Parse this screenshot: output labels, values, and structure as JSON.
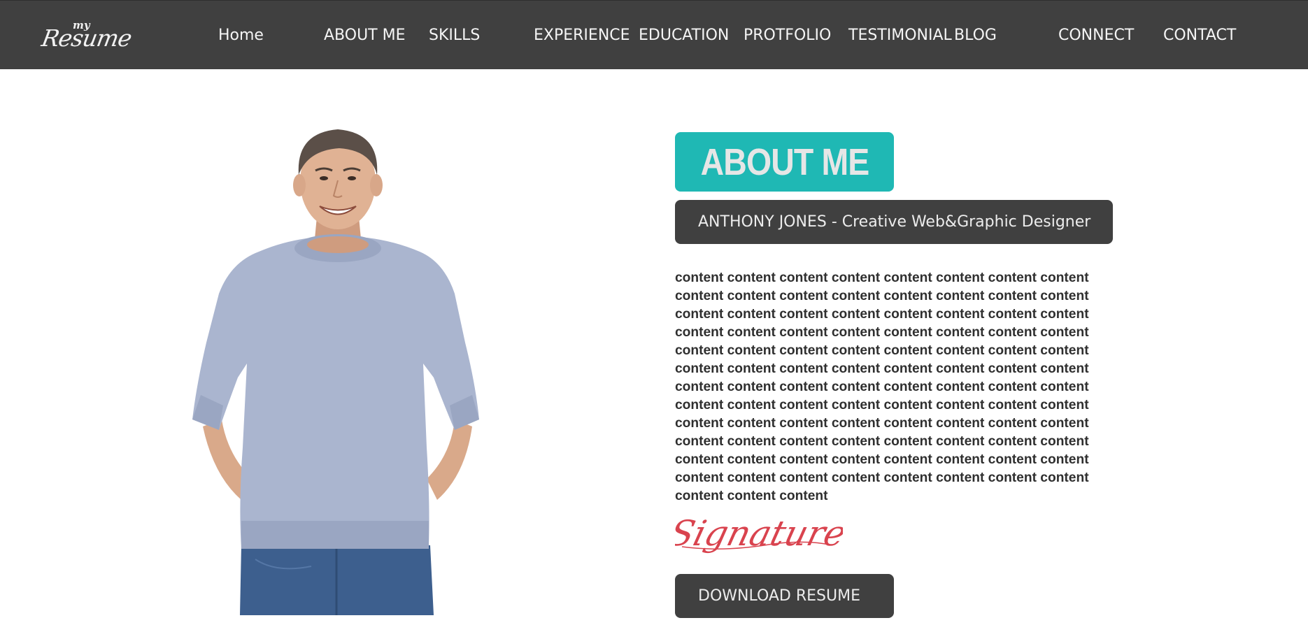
{
  "header": {
    "logo": {
      "small": "my",
      "main": "Resume"
    },
    "nav": [
      {
        "label": "Home"
      },
      {
        "label": "ABOUT ME"
      },
      {
        "label": "SKILLS"
      },
      {
        "label": "EXPERIENCE"
      },
      {
        "label": "EDUCATION"
      },
      {
        "label": "PROTFOLIO"
      },
      {
        "label": "TESTIMONIAL"
      },
      {
        "label": "BLOG"
      },
      {
        "label": "CONNECT"
      },
      {
        "label": "CONTACT"
      }
    ]
  },
  "about": {
    "title": "ABOUT ME",
    "role": "ANTHONY JONES - Creative Web&Graphic Designer",
    "bio": "content content content content content content content content content content content content content content content content content content content content content content content content content content content content content content content content content content content content content content content content content content content content content content content content content content content content content content content content content content content content content content content content content content content content content content content content content content content content content content content content content content content content content content content content content content content content content content content content content content content",
    "signature": "Signature",
    "download_label": "DOWNLOAD RESUME"
  },
  "colors": {
    "nav_background": "#404040",
    "accent_teal": "#1fb8b4",
    "nav_text": "#f5f5f5",
    "signature_red": "#d9434e"
  }
}
